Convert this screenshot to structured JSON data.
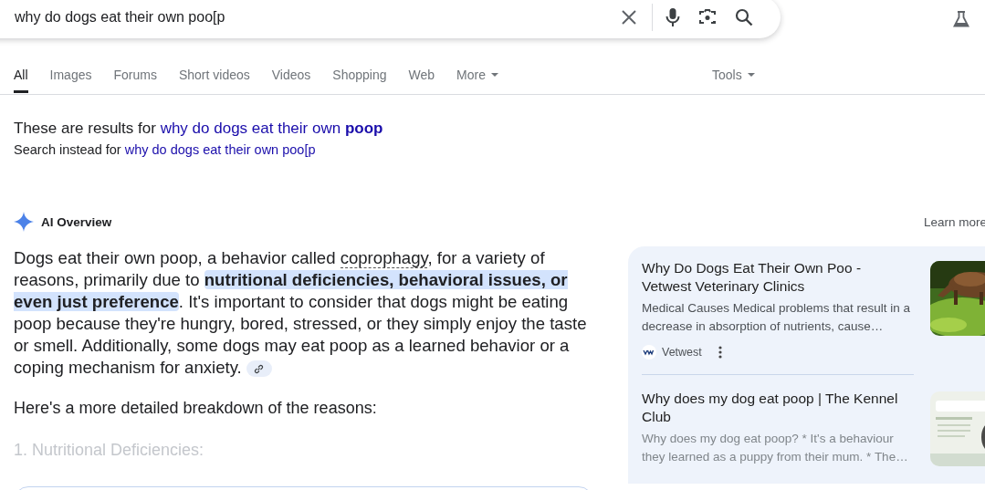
{
  "search": {
    "value": "why do dogs eat their own poo[p"
  },
  "tabs": [
    {
      "label": "All",
      "selected": true,
      "dropdown": false
    },
    {
      "label": "Images",
      "selected": false,
      "dropdown": false
    },
    {
      "label": "Forums",
      "selected": false,
      "dropdown": false
    },
    {
      "label": "Short videos",
      "selected": false,
      "dropdown": false
    },
    {
      "label": "Videos",
      "selected": false,
      "dropdown": false
    },
    {
      "label": "Shopping",
      "selected": false,
      "dropdown": false
    },
    {
      "label": "Web",
      "selected": false,
      "dropdown": false
    },
    {
      "label": "More",
      "selected": false,
      "dropdown": true
    }
  ],
  "tools": {
    "label": "Tools"
  },
  "spelling": {
    "showing_prefix": "These are results for",
    "showing_query": "why do dogs eat their own **poop**",
    "instead_prefix": "Search instead for",
    "instead_query": "why do dogs eat their own poo[p"
  },
  "ai_overview": {
    "title": "AI Overview",
    "learn_more": "Learn more",
    "summary": [
      {
        "kind": "plain",
        "text": "Dogs eat their own poop, a behavior called "
      },
      {
        "kind": "term",
        "text": "coprophagy"
      },
      {
        "kind": "plain",
        "text": ", for a variety of reasons, primarily due to "
      },
      {
        "kind": "highlight",
        "text": "nutritional deficiencies, behavioral issues, or even just preference"
      },
      {
        "kind": "plain",
        "text": ". It's important to consider that dogs might be eating poop because they're hungry, bored, stressed, or they simply enjoy the taste or smell. Additionally, some dogs may eat poop as a learned behavior or a coping mechanism for anxiety."
      }
    ],
    "intro": "Here's a more detailed breakdown of the reasons:",
    "heading": "1. Nutritional Deficiencies:",
    "sources": [
      {
        "title": "Why Do Dogs Eat Their Own Poo - Vetwest Veterinary Clinics",
        "snippet": "Medical Causes Medical problems that result in a decrease in absorption of nutrients, cause…",
        "site": "Vetwest",
        "faded": false
      },
      {
        "title": "Why does my dog eat poop | The Kennel Club",
        "snippet": "Why does my dog eat poop? * It's a behaviour they learned as a puppy from their mum. * The…",
        "faded": true
      }
    ]
  }
}
